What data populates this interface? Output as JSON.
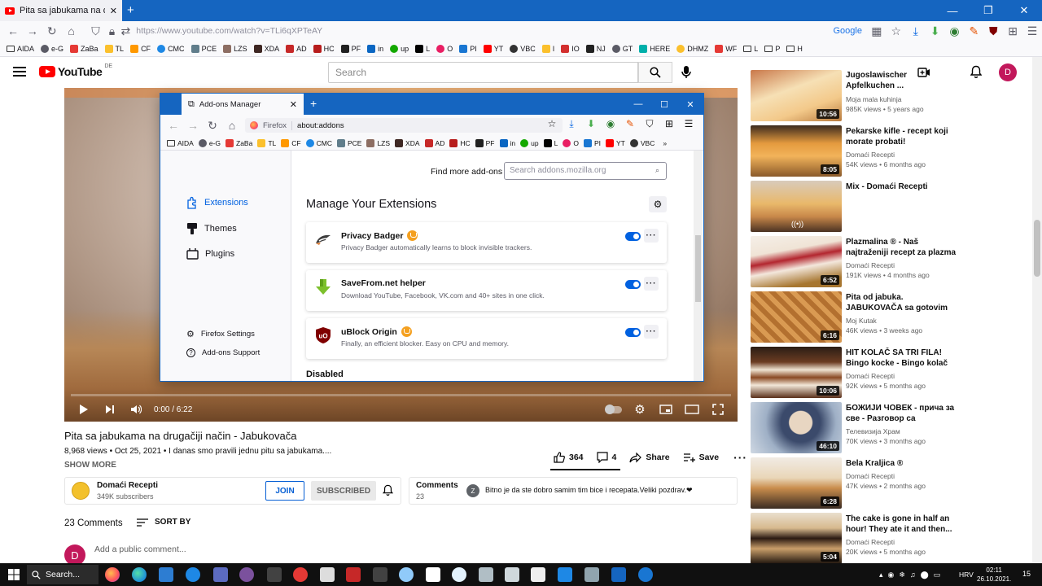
{
  "browser": {
    "tab_title": "Pita sa jabukama na drugačiji n",
    "url": "https://www.youtube.com/watch?v=TLi6qXPTeAY",
    "google_label": "Google",
    "bookmarks": [
      "AIDA",
      "e-G",
      "ZaBa",
      "TL",
      "CF",
      "CMC",
      "PCE",
      "LZS",
      "XDA",
      "AD",
      "HC",
      "PF",
      "in",
      "up",
      "L",
      "O",
      "PI",
      "YT",
      "VBC",
      "I",
      "IO",
      "NJ",
      "GT",
      "HERE",
      "DHMZ",
      "WF",
      "L",
      "P",
      "H"
    ]
  },
  "youtube": {
    "logo_text": "YouTube",
    "logo_region": "DE",
    "search_placeholder": "Search",
    "user_initial": "D",
    "video": {
      "time": "0:00 / 6:22",
      "title": "Pita sa jabukama na drugačiji način - Jabukovača",
      "meta": "8,968 views • Oct 25, 2021 • I danas smo pravili jednu pitu sa jabukama....",
      "show_more": "SHOW MORE",
      "likes": "364",
      "comments_count_btn": "4",
      "share": "Share",
      "save": "Save"
    },
    "channel": {
      "name": "Domaći Recepti",
      "subs": "349K subscribers",
      "join": "JOIN",
      "subscribed": "SUBSCRIBED"
    },
    "comments_card": {
      "title": "Comments",
      "count": "23",
      "avatar": "Z",
      "text": "Bitno je da ste dobro samim tim bice i recepata.Veliki pozdrav.❤"
    },
    "comments_header": "23 Comments",
    "sort_by": "SORT BY",
    "add_comment": "Add a public comment...",
    "sidebar": [
      {
        "title": "Jugoslawischer Apfelkuchen ...",
        "channel": "Moja mala kuhinja",
        "meta": "985K views • 5 years ago",
        "duration": "10:56"
      },
      {
        "title": "Pekarske kifle - recept koji morate probati!",
        "channel": "Domaći Recepti",
        "meta": "54K views • 6 months ago",
        "duration": "8:05"
      },
      {
        "title": "Mix - Domaći Recepti",
        "channel": "",
        "meta": "",
        "duration": ""
      },
      {
        "title": "Plazmalina ® - Naš najtraženiji recept za plazma tortu sa...",
        "channel": "Domaći Recepti",
        "meta": "191K views • 4 months ago",
        "duration": "6:52"
      },
      {
        "title": "Pita od jabuka. JABUKOVAČA sa gotovim korama,...",
        "channel": "Moj Kutak",
        "meta": "46K views • 3 weeks ago",
        "duration": "6:16"
      },
      {
        "title": "HIT KOLAČ SA TRI FILA! Bingo kocke - Bingo kolač",
        "channel": "Domaći Recepti",
        "meta": "92K views • 5 months ago",
        "duration": "10:06"
      },
      {
        "title": "БОЖИЈИ ЧОВЕК - прича за све - Разговор са режисеро...",
        "channel": "Телевизија Храм",
        "meta": "70K views • 3 months ago",
        "duration": "46:10"
      },
      {
        "title": "Bela Kraljica ®",
        "channel": "Domaći Recepti",
        "meta": "47K views • 2 months ago",
        "duration": "6:28"
      },
      {
        "title": "The cake is gone in half an hour! They ate it and then...",
        "channel": "Domaći Recepti",
        "meta": "20K views • 5 months ago",
        "duration": "5:04"
      }
    ]
  },
  "addons": {
    "tab_title": "Add-ons Manager",
    "url_label": "Firefox",
    "url": "about:addons",
    "bookmarks": [
      "AIDA",
      "e-G",
      "ZaBa",
      "TL",
      "CF",
      "CMC",
      "PCE",
      "LZS",
      "XDA",
      "AD",
      "HC",
      "PF",
      "in",
      "up",
      "L",
      "O",
      "PI",
      "YT",
      "VBC"
    ],
    "nav": {
      "extensions": "Extensions",
      "themes": "Themes",
      "plugins": "Plugins",
      "settings": "Firefox Settings",
      "support": "Add-ons Support"
    },
    "find_more": "Find more add-ons",
    "search_placeholder": "Search addons.mozilla.org",
    "heading": "Manage Your Extensions",
    "extensions": [
      {
        "name": "Privacy Badger",
        "desc": "Privacy Badger automatically learns to block invisible trackers.",
        "enabled": true
      },
      {
        "name": "SaveFrom.net helper",
        "desc": "Download YouTube, Facebook, VK.com and 40+ sites in one click.",
        "enabled": true
      },
      {
        "name": "uBlock Origin",
        "desc": "Finally, an efficient blocker. Easy on CPU and memory.",
        "enabled": true
      }
    ],
    "disabled_heading": "Disabled"
  },
  "taskbar": {
    "search": "Search...",
    "lang": "HRV",
    "time": "02:11",
    "date": "26.10.2021.",
    "notif": "15"
  },
  "colors": {
    "accent": "#1565c0",
    "yt_red": "#ff0000",
    "toggle": "#0061e0"
  }
}
